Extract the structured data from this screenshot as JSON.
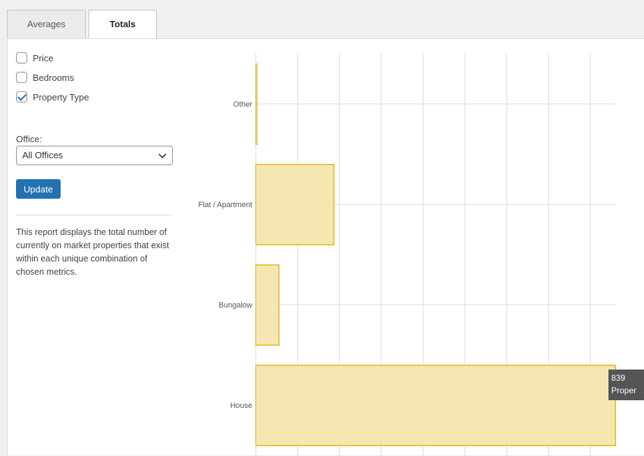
{
  "tabs": [
    {
      "label": "Averages",
      "active": false
    },
    {
      "label": "Totals",
      "active": true
    }
  ],
  "filters": {
    "checkboxes": [
      {
        "label": "Price",
        "checked": false
      },
      {
        "label": "Bedrooms",
        "checked": false
      },
      {
        "label": "Property Type",
        "checked": true
      }
    ],
    "office_label": "Office:",
    "office_selected": "All Offices",
    "update_label": "Update"
  },
  "description": "This report displays the total number of currently on market properties that exist within each unique combination of chosen metrics.",
  "colors": {
    "bar_fill": "#f5e6ae",
    "bar_stroke": "#e8c33f",
    "grid": "#d9d9d9",
    "button": "#2271b1",
    "tooltip": "#555555"
  },
  "chart_data": {
    "type": "bar",
    "orientation": "horizontal",
    "categories": [
      "Other",
      "Flat / Apartment",
      "Bungalow",
      "House"
    ],
    "values": [
      2,
      182,
      54,
      839
    ],
    "grid": true,
    "tooltip": {
      "value": "839",
      "label": "Proper"
    }
  }
}
